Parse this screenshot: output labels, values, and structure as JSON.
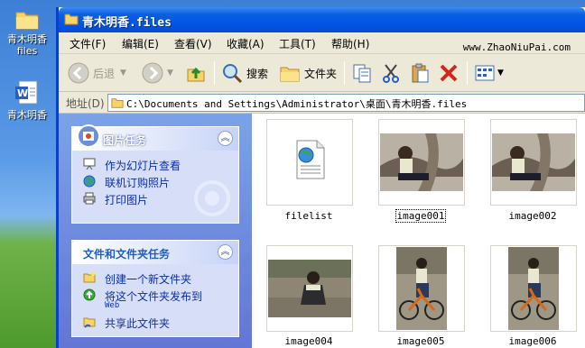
{
  "desktop": {
    "icons": [
      {
        "label1": "青木明香",
        "label2": "files"
      },
      {
        "label1": "青木明香",
        "label2": ""
      }
    ]
  },
  "window": {
    "title": "青木明香.files",
    "menu": [
      "文件(F)",
      "编辑(E)",
      "查看(V)",
      "收藏(A)",
      "工具(T)",
      "帮助(H)"
    ],
    "watermark": "www.ZhaoNiuPai.com",
    "toolbar": {
      "back": "后退",
      "search": "搜索",
      "folders": "文件夹"
    },
    "address": {
      "label": "地址(D)",
      "path": "C:\\Documents and Settings\\Administrator\\桌面\\青木明香.files"
    }
  },
  "taskpane": {
    "picture_tasks": {
      "title": "图片任务",
      "items": [
        "作为幻灯片查看",
        "联机订购照片",
        "打印图片"
      ]
    },
    "file_tasks": {
      "title": "文件和文件夹任务",
      "items": [
        "创建一个新文件夹",
        "将这个文件夹发布到",
        "共享此文件夹"
      ],
      "publish_suffix": "Web"
    }
  },
  "files": [
    {
      "name": "filelist",
      "kind": "document"
    },
    {
      "name": "image001",
      "kind": "photo-landscape",
      "selected": true
    },
    {
      "name": "image002",
      "kind": "photo-landscape"
    },
    {
      "name": "image004",
      "kind": "photo-squat"
    },
    {
      "name": "image005",
      "kind": "photo-bike"
    },
    {
      "name": "image006",
      "kind": "photo-bike"
    }
  ],
  "colors": {
    "titlebar": "#0054e3",
    "taskpane": "#6f8fe0",
    "link": "#0c2fa8"
  }
}
